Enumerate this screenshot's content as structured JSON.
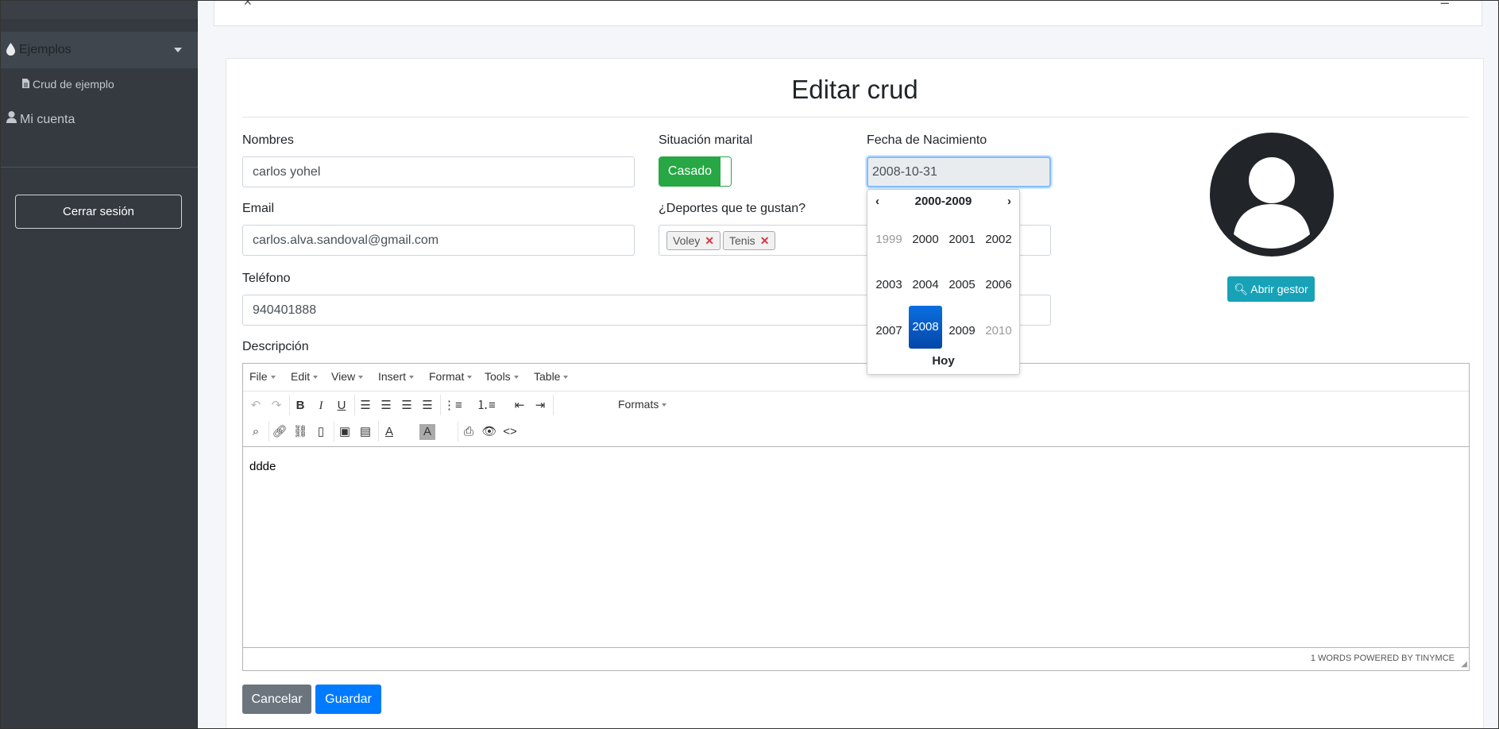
{
  "sidebar": {
    "items": [
      {
        "label": "Ejemplos",
        "icon": "tint-icon"
      },
      {
        "label": "Crud de ejemplo",
        "icon": "file-icon"
      },
      {
        "label": "Mi cuenta",
        "icon": "user-icon"
      }
    ],
    "logout_label": "Cerrar sesión"
  },
  "page": {
    "title": "Editar crud"
  },
  "form": {
    "nombres": {
      "label": "Nombres",
      "value": "carlos yohel"
    },
    "situacion": {
      "label": "Situación marital",
      "value": "Casado"
    },
    "fecha": {
      "label": "Fecha de Nacimiento",
      "value": "2008-10-31"
    },
    "email": {
      "label": "Email",
      "value": "carlos.alva.sandoval@gmail.com"
    },
    "deportes": {
      "label": "¿Deportes que te gustan?",
      "tags": [
        "Voley",
        "Tenis"
      ],
      "remove_glyph": "✕"
    },
    "telefono": {
      "label": "Teléfono",
      "value": "940401888"
    },
    "descripcion": {
      "label": "Descripción",
      "content": "ddde"
    }
  },
  "avatar": {
    "button_label": "Abrir gestor"
  },
  "editor": {
    "menu": [
      "File",
      "Edit",
      "View",
      "Insert",
      "Format",
      "Tools",
      "Table"
    ],
    "formats_label": "Formats",
    "status": "1 WORDS POWERED BY TINYMCE"
  },
  "datepicker": {
    "title": "2000-2009",
    "prev": "‹",
    "next": "›",
    "years": [
      "1999",
      "2000",
      "2001",
      "2002",
      "2003",
      "2004",
      "2005",
      "2006",
      "2007",
      "2008",
      "2009",
      "2010"
    ],
    "selected": "2008",
    "today_label": "Hoy"
  },
  "actions": {
    "cancel_label": "Cancelar",
    "save_label": "Guardar"
  },
  "colors": {
    "sidebar": "#343a40",
    "success": "#28a745",
    "primary": "#007bff",
    "info": "#17a2b8",
    "secondary": "#6c757d"
  }
}
